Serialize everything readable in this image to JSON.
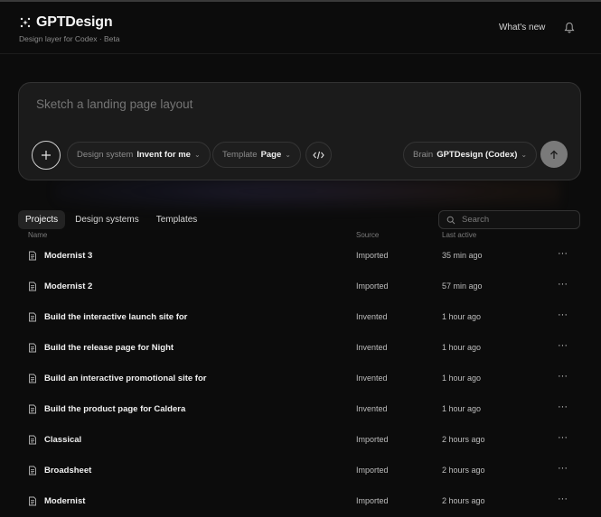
{
  "header": {
    "title": "GPTDesign",
    "subtitle": "Design layer for Codex · Beta",
    "whats_new": "What's new",
    "logo_icon": "sparkle-icon",
    "bell_icon": "bell-icon"
  },
  "composer": {
    "placeholder": "Sketch a landing page layout",
    "design_system": {
      "label": "Design system",
      "value": "Invent for me"
    },
    "template": {
      "label": "Template",
      "value": "Page"
    },
    "brain": {
      "label": "Brain",
      "value": "GPTDesign (Codex)"
    },
    "plus_icon": "plus-icon",
    "code_icon": "code-icon",
    "send_icon": "arrow-up-icon"
  },
  "tabs": [
    "Projects",
    "Design systems",
    "Templates"
  ],
  "active_tab": "Projects",
  "search": {
    "placeholder": "Search"
  },
  "columns": {
    "name": "Name",
    "source": "Source",
    "last_active": "Last active"
  },
  "projects": [
    {
      "name": "Modernist 3",
      "source": "Imported",
      "last_active": "35 min ago"
    },
    {
      "name": "Modernist 2",
      "source": "Imported",
      "last_active": "57 min ago"
    },
    {
      "name": "Build the interactive launch site for",
      "source": "Invented",
      "last_active": "1 hour ago"
    },
    {
      "name": "Build the release page for Night",
      "source": "Invented",
      "last_active": "1 hour ago"
    },
    {
      "name": "Build an interactive promotional site for",
      "source": "Invented",
      "last_active": "1 hour ago"
    },
    {
      "name": "Build the product page for Caldera",
      "source": "Invented",
      "last_active": "1 hour ago"
    },
    {
      "name": "Classical",
      "source": "Imported",
      "last_active": "2 hours ago"
    },
    {
      "name": "Broadsheet",
      "source": "Imported",
      "last_active": "2 hours ago"
    },
    {
      "name": "Modernist",
      "source": "Imported",
      "last_active": "2 hours ago"
    }
  ],
  "more_label": "···",
  "colors": {
    "background": "#0c0c0c",
    "panel": "#1b1b1b",
    "send": "#7a7a7a"
  }
}
